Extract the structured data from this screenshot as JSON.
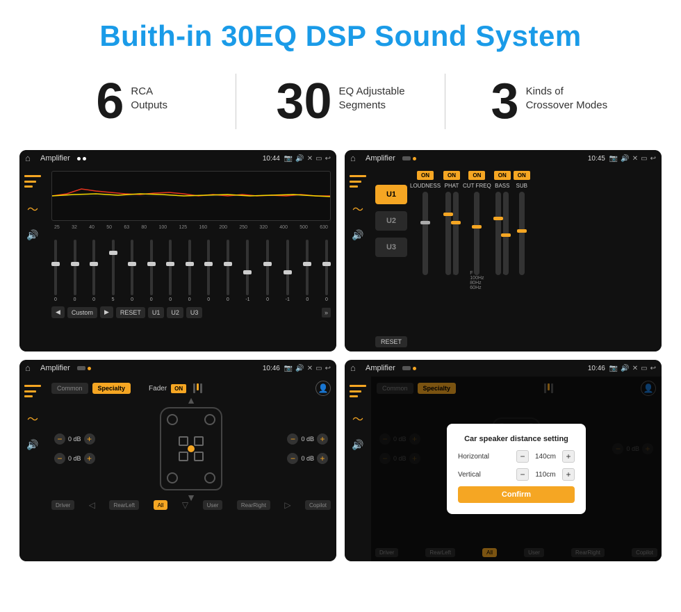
{
  "page": {
    "title": "Buith-in 30EQ DSP Sound System",
    "bg_color": "#ffffff"
  },
  "stats": [
    {
      "number": "6",
      "label_line1": "RCA",
      "label_line2": "Outputs"
    },
    {
      "number": "30",
      "label_line1": "EQ Adjustable",
      "label_line2": "Segments"
    },
    {
      "number": "3",
      "label_line1": "Kinds of",
      "label_line2": "Crossover Modes"
    }
  ],
  "screens": {
    "eq_screen": {
      "title": "Amplifier",
      "time": "10:44",
      "freqs": [
        "25",
        "32",
        "40",
        "50",
        "63",
        "80",
        "100",
        "125",
        "160",
        "200",
        "250",
        "320",
        "400",
        "500",
        "630"
      ],
      "values": [
        "0",
        "0",
        "0",
        "5",
        "0",
        "0",
        "0",
        "0",
        "0",
        "0",
        "-1",
        "0",
        "-1"
      ],
      "buttons": [
        "Custom",
        "RESET",
        "U1",
        "U2",
        "U3"
      ],
      "play_label": "▶",
      "prev_label": "◀"
    },
    "amp_screen": {
      "title": "Amplifier",
      "time": "10:45",
      "u_buttons": [
        "U1",
        "U2",
        "U3"
      ],
      "controls": [
        {
          "toggle": "ON",
          "label": "LOUDNESS"
        },
        {
          "toggle": "ON",
          "label": "PHAT"
        },
        {
          "toggle": "ON",
          "label": "CUT FREQ"
        },
        {
          "toggle": "ON",
          "label": "BASS"
        },
        {
          "toggle": "ON",
          "label": "SUB"
        }
      ],
      "reset_label": "RESET"
    },
    "fader_screen": {
      "title": "Amplifier",
      "time": "10:46",
      "tabs": [
        "Common",
        "Specialty"
      ],
      "fader_label": "Fader",
      "toggle": "ON",
      "db_values": [
        "0 dB",
        "0 dB",
        "0 dB",
        "0 dB"
      ],
      "location_buttons": [
        "Driver",
        "RearLeft",
        "All",
        "User",
        "RearRight",
        "Copilot"
      ]
    },
    "dialog_screen": {
      "title": "Amplifier",
      "time": "10:46",
      "tabs": [
        "Common",
        "Specialty"
      ],
      "dialog_title": "Car speaker distance setting",
      "horizontal_label": "Horizontal",
      "horizontal_value": "140cm",
      "vertical_label": "Vertical",
      "vertical_value": "110cm",
      "confirm_label": "Confirm",
      "db_right": [
        "0 dB",
        "0 dB"
      ],
      "location_buttons_bottom": [
        "RearLeft",
        "All",
        "User",
        "RearRight"
      ]
    }
  }
}
